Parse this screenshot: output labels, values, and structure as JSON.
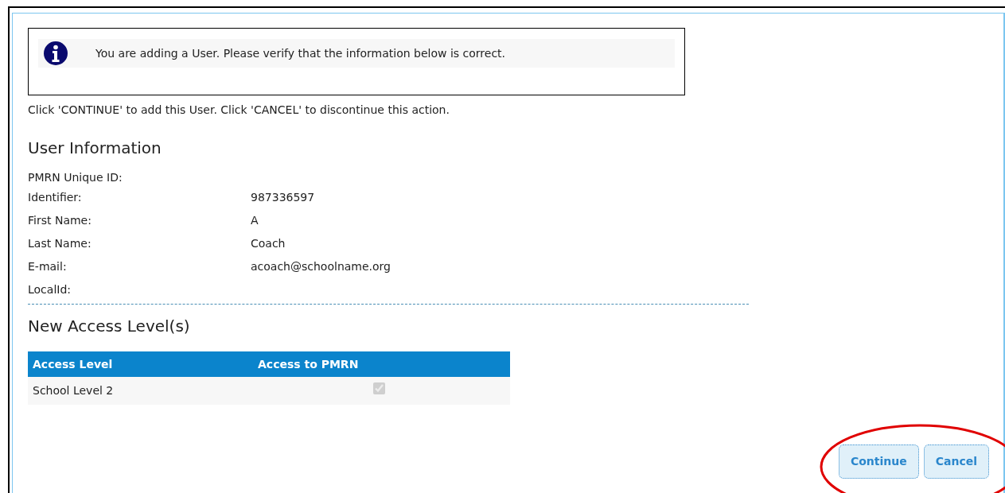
{
  "notice": {
    "message": "You are adding a User. Please verify that the information below is correct."
  },
  "instruction": "Click 'CONTINUE' to add this User. Click 'CANCEL' to discontinue this action.",
  "user_information": {
    "heading": "User Information",
    "fields": [
      {
        "label": "PMRN Unique ID:"
      },
      {
        "label": "Identifier:",
        "value": "987336597"
      },
      {
        "label": "First Name:",
        "value": "A"
      },
      {
        "label": "Last Name:",
        "value": "Coach"
      },
      {
        "label": "E-mail:",
        "value": "acoach@schoolname.org"
      },
      {
        "label": "LocalId:"
      }
    ]
  },
  "access_levels": {
    "heading": "New Access Level(s)",
    "columns": [
      "Access Level",
      "Access to PMRN"
    ],
    "rows": [
      {
        "access_level": "School Level 2",
        "checked": true,
        "disabled": true
      }
    ]
  },
  "buttons": [
    "Continue",
    "Cancel"
  ],
  "annotation": {
    "kind": "ellipse",
    "color": "#e00000"
  }
}
